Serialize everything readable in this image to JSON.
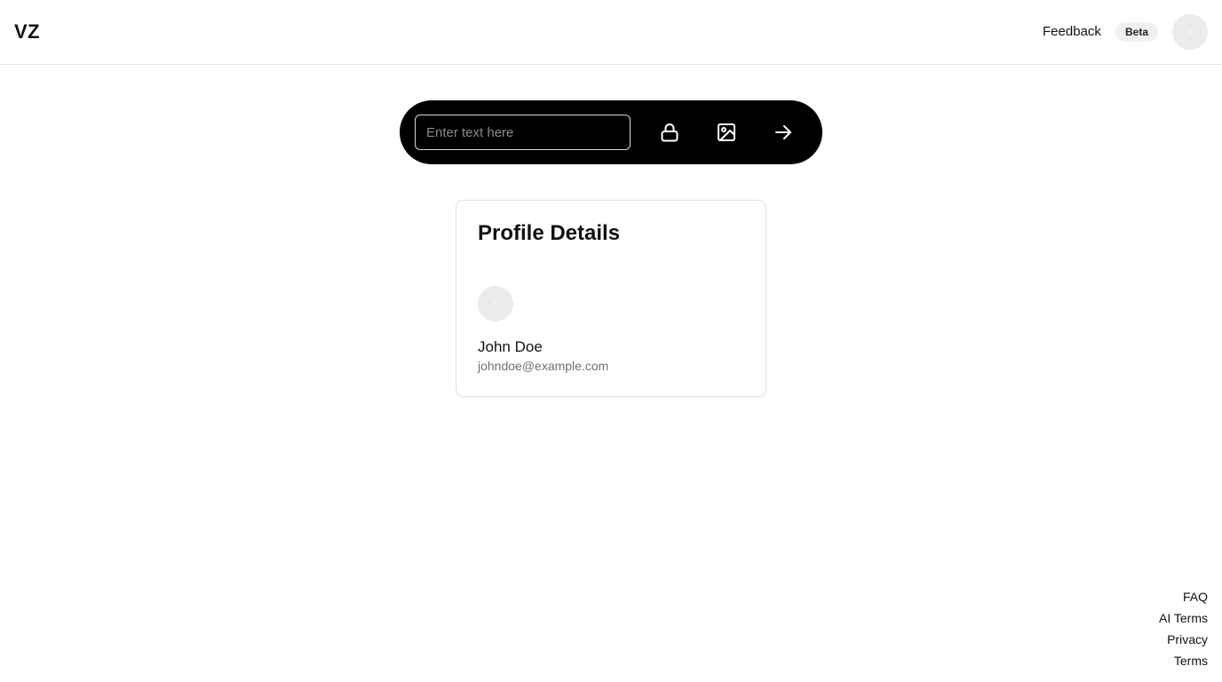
{
  "header": {
    "logo": "VZ",
    "feedback_label": "Feedback",
    "beta_badge": "Beta",
    "avatar_icon": "user-avatar-icon"
  },
  "input_bar": {
    "placeholder": "Enter text here",
    "value": "",
    "buttons": [
      {
        "icon": "lock-icon"
      },
      {
        "icon": "image-icon"
      },
      {
        "icon": "arrow-right-icon"
      }
    ],
    "background_color": "#000000"
  },
  "profile": {
    "title": "Profile Details",
    "avatar_icon": "user-avatar-icon",
    "name": "John Doe",
    "email": "johndoe@example.com"
  },
  "footer": {
    "links": [
      "FAQ",
      "AI Terms",
      "Privacy",
      "Terms"
    ]
  }
}
